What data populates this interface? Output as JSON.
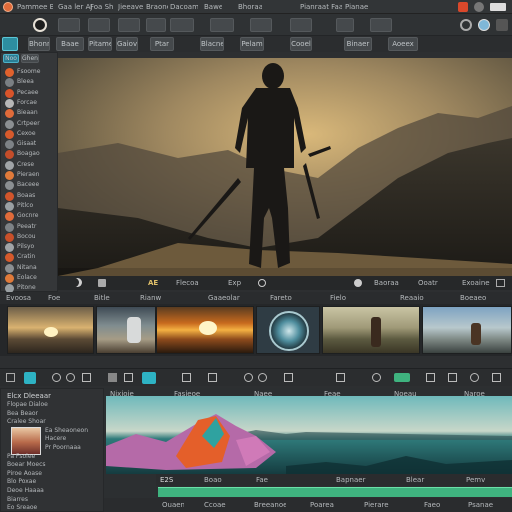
{
  "app": {
    "menu": [
      "Pammee Bbaar B",
      "Gaa ler AJ",
      "Foa Shlv",
      "Jieeaver",
      "Braone",
      "Dacoamm",
      "Bawe",
      "Bhoraa",
      "Pianraat Faao",
      "Pianae"
    ]
  },
  "toolbar": {
    "buttons": [
      "Bhonne",
      "Baae",
      "Pitame",
      "Gaiov",
      "Ptar",
      "Blacne",
      "Pelam",
      "Cooel",
      "Binaer",
      "Aoeex"
    ]
  },
  "left_panel": {
    "tabs": [
      "Noo",
      "Ghen"
    ],
    "items": [
      "Fsoome",
      "Bleea",
      "Pecaee",
      "Forcae",
      "Bieaan",
      "Crtpeer",
      "Cexoe",
      "Gisaat",
      "Boagao",
      "Crese",
      "Pieraen",
      "Baceee",
      "Boaas",
      "Pitlco",
      "Gocnre",
      "Peeatr",
      "Bocou",
      "Pilsyo",
      "Cratin",
      "Nitana",
      "Eolace",
      "Pitone"
    ]
  },
  "viewer": {
    "controls": [
      "AE",
      "Flecoa",
      "Exp",
      "Baoraa",
      "Ooatr",
      "Exoaine"
    ]
  },
  "timeline_header": {
    "labels": [
      "Evoosa",
      "Foe",
      "Bitle",
      "Rianw",
      "Gaaeolar",
      "Fareto",
      "Fielo",
      "Reaaio",
      "Boeaeo"
    ]
  },
  "bottom_left": {
    "title": "Elcx Dleeaar",
    "rows": [
      "Flopae Dialoe",
      "Bea Beaor",
      "Cralee Shoar",
      "Ea Sheaoneon",
      "Hacere",
      "Pr Poornaaa",
      "Pa Fsolee",
      "Boear Moecs",
      "Piroe Aoase",
      "Blo Poxae",
      "Deoe Haaaa",
      "Biarres",
      "Eo Sreaoe"
    ]
  },
  "bottom_timeline": {
    "top_labels": [
      "Nixioie",
      "Fasieoe",
      "Naee",
      "Feae",
      "Noeau",
      "Naroe"
    ],
    "track_label": "E2S",
    "track_items": [
      "Boao",
      "Fae",
      "Bapnaer",
      "Blear",
      "Pemv"
    ],
    "bottom_labels": [
      "Ouaen",
      "Ccoae",
      "Breeanoe",
      "Poarea",
      "Pierare",
      "Faeo",
      "Psanae"
    ]
  },
  "colors": {
    "bg": "#2d2f31",
    "accent_teal": "#2db6b8",
    "accent_green": "#3fb37f",
    "record_red": "#d9482b"
  }
}
